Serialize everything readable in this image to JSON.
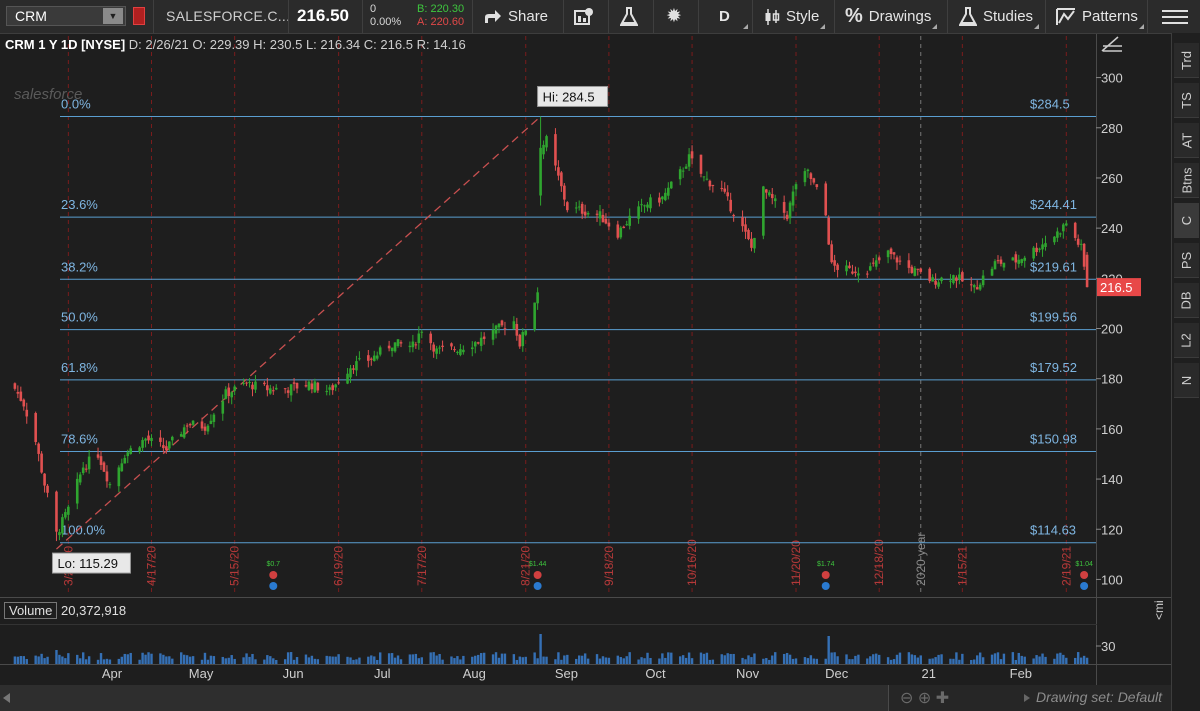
{
  "toolbar": {
    "symbol": "CRM",
    "company": "SALESFORCE.C...",
    "last": "216.50",
    "change": "0",
    "change_pct": "0.00%",
    "bid": "B: 220.30",
    "ask": "A: 220.60",
    "share": "Share",
    "aggregation": "D",
    "style": "Style",
    "drawings": "Drawings",
    "studies": "Studies",
    "patterns": "Patterns"
  },
  "header": {
    "symbol": "CRM 1 Y 1D [NYSE]",
    "date": "D: 2/26/21",
    "open": "O: 229.39",
    "high": "H: 230.5",
    "low": "L: 216.34",
    "close": "C: 216.5",
    "range": "R: 14.16"
  },
  "volume": {
    "label": "Volume",
    "value": "20,372,918"
  },
  "side_tabs": [
    "Trd",
    "TS",
    "AT",
    "Btns",
    "C",
    "PS",
    "DB",
    "L2",
    "N"
  ],
  "drawing_set": "Drawing set: Default",
  "mini_label": "<mi",
  "watermark": "salesforce",
  "colors": {
    "up": "#2fa52f",
    "down": "#e05050",
    "fib": "#6aa6d6",
    "bg": "#1e1e1e",
    "last_price_marker": "#e84848"
  },
  "chart_data": {
    "type": "candlestick",
    "symbol": "CRM",
    "timeframe": "1 Y 1D",
    "y_range": [
      93,
      309
    ],
    "y_ticks": [
      100,
      120,
      140,
      160,
      180,
      200,
      220,
      240,
      260,
      280,
      300
    ],
    "volume_axis_tick": "30",
    "x_month_labels": [
      {
        "label": "Apr",
        "date": "2020-04-01"
      },
      {
        "label": "May",
        "date": "2020-05-01"
      },
      {
        "label": "Jun",
        "date": "2020-06-01"
      },
      {
        "label": "Jul",
        "date": "2020-07-01"
      },
      {
        "label": "Aug",
        "date": "2020-08-01"
      },
      {
        "label": "Sep",
        "date": "2020-09-01"
      },
      {
        "label": "Oct",
        "date": "2020-10-01"
      },
      {
        "label": "Nov",
        "date": "2020-11-01"
      },
      {
        "label": "Dec",
        "date": "2020-12-01"
      },
      {
        "label": "21",
        "date": "2021-01-01"
      },
      {
        "label": "Feb",
        "date": "2021-02-01"
      }
    ],
    "date_markers": [
      {
        "label": "3/20/20",
        "date": "2020-03-20"
      },
      {
        "label": "4/17/20",
        "date": "2020-04-17"
      },
      {
        "label": "5/15/20",
        "date": "2020-05-15"
      },
      {
        "label": "6/19/20",
        "date": "2020-06-19"
      },
      {
        "label": "7/17/20",
        "date": "2020-07-17"
      },
      {
        "label": "8/21/20",
        "date": "2020-08-21"
      },
      {
        "label": "9/18/20",
        "date": "2020-09-18"
      },
      {
        "label": "10/16/20",
        "date": "2020-10-16"
      },
      {
        "label": "11/20/20",
        "date": "2020-11-20"
      },
      {
        "label": "12/18/20",
        "date": "2020-12-18"
      },
      {
        "label": "2020 year",
        "date": "2021-01-01"
      },
      {
        "label": "1/15/21",
        "date": "2021-01-15"
      },
      {
        "label": "2/19/21",
        "date": "2021-02-19"
      }
    ],
    "fibonacci": {
      "high": {
        "label": "Hi: 284.5",
        "value": 284.5,
        "date": "2020-08-26"
      },
      "low": {
        "label": "Lo: 115.29",
        "value": 115.29,
        "date": "2020-03-16"
      },
      "levels": [
        {
          "ratio": "0.0%",
          "value": 284.5,
          "label": "$284.5"
        },
        {
          "ratio": "23.6%",
          "value": 244.41,
          "label": "$244.41"
        },
        {
          "ratio": "38.2%",
          "value": 219.61,
          "label": "$219.61"
        },
        {
          "ratio": "50.0%",
          "value": 199.56,
          "label": "$199.56"
        },
        {
          "ratio": "61.8%",
          "value": 179.52,
          "label": "$179.52"
        },
        {
          "ratio": "78.6%",
          "value": 150.98,
          "label": "$150.98"
        },
        {
          "ratio": "100.0%",
          "value": 114.63,
          "label": "$114.63"
        }
      ]
    },
    "last_price": {
      "value": 216.5,
      "label": "216.5"
    },
    "dividend_markers": [
      {
        "date": "2020-05-28",
        "label": "$0.7"
      },
      {
        "date": "2020-08-25",
        "label": "$1.44"
      },
      {
        "date": "2020-11-30",
        "label": "$1.74"
      },
      {
        "date": "2021-02-25",
        "label": "$1.04"
      }
    ],
    "price_anchors": [
      {
        "date": "2020-03-01",
        "close": 178
      },
      {
        "date": "2020-03-05",
        "close": 170
      },
      {
        "date": "2020-03-09",
        "close": 155
      },
      {
        "date": "2020-03-12",
        "close": 138
      },
      {
        "date": "2020-03-16",
        "close": 118
      },
      {
        "date": "2020-03-20",
        "close": 128
      },
      {
        "date": "2020-03-25",
        "close": 145
      },
      {
        "date": "2020-03-30",
        "close": 150
      },
      {
        "date": "2020-04-03",
        "close": 138
      },
      {
        "date": "2020-04-08",
        "close": 150
      },
      {
        "date": "2020-04-15",
        "close": 156
      },
      {
        "date": "2020-04-22",
        "close": 152
      },
      {
        "date": "2020-04-29",
        "close": 162
      },
      {
        "date": "2020-05-05",
        "close": 161
      },
      {
        "date": "2020-05-12",
        "close": 174
      },
      {
        "date": "2020-05-19",
        "close": 178
      },
      {
        "date": "2020-05-26",
        "close": 176
      },
      {
        "date": "2020-06-02",
        "close": 176
      },
      {
        "date": "2020-06-09",
        "close": 178
      },
      {
        "date": "2020-06-16",
        "close": 175
      },
      {
        "date": "2020-06-23",
        "close": 185
      },
      {
        "date": "2020-06-30",
        "close": 188
      },
      {
        "date": "2020-07-07",
        "close": 194
      },
      {
        "date": "2020-07-14",
        "close": 193
      },
      {
        "date": "2020-07-17",
        "close": 200
      },
      {
        "date": "2020-07-22",
        "close": 191
      },
      {
        "date": "2020-07-29",
        "close": 192
      },
      {
        "date": "2020-08-05",
        "close": 195
      },
      {
        "date": "2020-08-12",
        "close": 200
      },
      {
        "date": "2020-08-17",
        "close": 203
      },
      {
        "date": "2020-08-19",
        "close": 194
      },
      {
        "date": "2020-08-21",
        "close": 200
      },
      {
        "date": "2020-08-25",
        "close": 215
      },
      {
        "date": "2020-08-26",
        "close": 272
      },
      {
        "date": "2020-08-28",
        "close": 275
      },
      {
        "date": "2020-09-01",
        "close": 260
      },
      {
        "date": "2020-09-04",
        "close": 248
      },
      {
        "date": "2020-09-09",
        "close": 247
      },
      {
        "date": "2020-09-15",
        "close": 245
      },
      {
        "date": "2020-09-21",
        "close": 238
      },
      {
        "date": "2020-09-25",
        "close": 244
      },
      {
        "date": "2020-10-01",
        "close": 250
      },
      {
        "date": "2020-10-06",
        "close": 252
      },
      {
        "date": "2020-10-12",
        "close": 262
      },
      {
        "date": "2020-10-15",
        "close": 268
      },
      {
        "date": "2020-10-20",
        "close": 260
      },
      {
        "date": "2020-10-26",
        "close": 255
      },
      {
        "date": "2020-11-02",
        "close": 240
      },
      {
        "date": "2020-11-05",
        "close": 232
      },
      {
        "date": "2020-11-09",
        "close": 255
      },
      {
        "date": "2020-11-13",
        "close": 250
      },
      {
        "date": "2020-11-17",
        "close": 245
      },
      {
        "date": "2020-11-20",
        "close": 258
      },
      {
        "date": "2020-11-24",
        "close": 262
      },
      {
        "date": "2020-11-27",
        "close": 255
      },
      {
        "date": "2020-11-30",
        "close": 245
      },
      {
        "date": "2020-12-02",
        "close": 225
      },
      {
        "date": "2020-12-08",
        "close": 223
      },
      {
        "date": "2020-12-15",
        "close": 224
      },
      {
        "date": "2020-12-21",
        "close": 230
      },
      {
        "date": "2020-12-28",
        "close": 224
      },
      {
        "date": "2021-01-05",
        "close": 219
      },
      {
        "date": "2021-01-12",
        "close": 221
      },
      {
        "date": "2021-01-19",
        "close": 216
      },
      {
        "date": "2021-01-26",
        "close": 226
      },
      {
        "date": "2021-02-02",
        "close": 227
      },
      {
        "date": "2021-02-09",
        "close": 232
      },
      {
        "date": "2021-02-16",
        "close": 238
      },
      {
        "date": "2021-02-19",
        "close": 242
      },
      {
        "date": "2021-02-22",
        "close": 236
      },
      {
        "date": "2021-02-24",
        "close": 232
      },
      {
        "date": "2021-02-26",
        "close": 216.5
      }
    ]
  }
}
